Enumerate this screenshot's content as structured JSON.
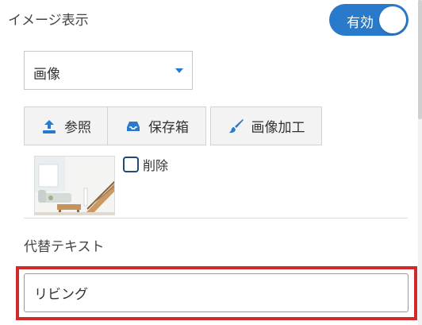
{
  "image_display": {
    "label": "イメージ表示",
    "toggle": {
      "label": "有効",
      "state": "on",
      "color": "#2a7acb"
    }
  },
  "image_source": {
    "selected": "画像"
  },
  "buttons": {
    "browse": {
      "label": "参照",
      "icon": "upload-icon"
    },
    "storage": {
      "label": "保存箱",
      "icon": "inbox-tray-icon"
    },
    "edit": {
      "label": "画像加工",
      "icon": "paintbrush-icon"
    }
  },
  "preview": {
    "delete_label": "削除",
    "delete_checked": false
  },
  "alt_text": {
    "label": "代替テキスト",
    "value": "リビング"
  },
  "colors": {
    "accent": "#2a7acb",
    "highlight": "#d12a2a"
  }
}
